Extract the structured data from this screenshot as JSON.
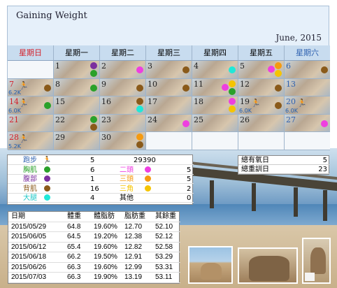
{
  "calendar": {
    "title": "Gaining Weight",
    "month_label": "June, 2015",
    "weekdays": [
      "星期日",
      "星期一",
      "星期二",
      "星期三",
      "星期四",
      "星期五",
      "星期六"
    ],
    "weekday_colors": [
      "#d4202a",
      "#000000",
      "#000000",
      "#000000",
      "#000000",
      "#000000",
      "#2f62b0"
    ],
    "weeks": [
      [
        {
          "day": "",
          "color": "",
          "runner": false,
          "dist": "",
          "dots": []
        },
        {
          "day": "1",
          "color": "normal",
          "runner": false,
          "dist": "",
          "dots": [
            "#7b2f9e",
            "#2aa12a"
          ]
        },
        {
          "day": "2",
          "color": "normal",
          "runner": false,
          "dist": "",
          "dots": [
            "#ee3fe0"
          ]
        },
        {
          "day": "3",
          "color": "normal",
          "runner": false,
          "dist": "",
          "dots": [
            "#8a5a1a"
          ]
        },
        {
          "day": "4",
          "color": "normal",
          "runner": false,
          "dist": "",
          "dots": [
            "#20e8d8"
          ]
        },
        {
          "day": "5",
          "color": "normal",
          "runner": false,
          "dist": "",
          "dots": [
            "#ee3fe0",
            "#f59a10",
            "#f5c400"
          ]
        },
        {
          "day": "6",
          "color": "blue",
          "runner": false,
          "dist": "",
          "dots": [
            "#8a5a1a"
          ]
        }
      ],
      [
        {
          "day": "7",
          "color": "red",
          "runner": true,
          "dist": "6.2K",
          "dots": [
            "#8a5a1a"
          ]
        },
        {
          "day": "8",
          "color": "normal",
          "runner": false,
          "dist": "",
          "dots": [
            "#2aa12a"
          ]
        },
        {
          "day": "9",
          "color": "normal",
          "runner": false,
          "dist": "",
          "dots": [
            "#8a5a1a"
          ]
        },
        {
          "day": "10",
          "color": "normal",
          "runner": false,
          "dist": "",
          "dots": [
            "#8a5a1a"
          ]
        },
        {
          "day": "11",
          "color": "normal",
          "runner": false,
          "dist": "",
          "dots": [
            "#ee3fe0",
            "#f5c400",
            "#2aa12a"
          ]
        },
        {
          "day": "12",
          "color": "normal",
          "runner": false,
          "dist": "",
          "dots": [
            "#8a5a1a"
          ]
        },
        {
          "day": "13",
          "color": "blue",
          "runner": false,
          "dist": "",
          "dots": []
        }
      ],
      [
        {
          "day": "14",
          "color": "red",
          "runner": true,
          "dist": "6.0K",
          "dots": [
            "#2aa12a"
          ]
        },
        {
          "day": "15",
          "color": "normal",
          "runner": false,
          "dist": "",
          "dots": []
        },
        {
          "day": "16",
          "color": "normal",
          "runner": false,
          "dist": "",
          "dots": [
            "#8a5a1a",
            "#20e8d8"
          ]
        },
        {
          "day": "17",
          "color": "normal",
          "runner": false,
          "dist": "",
          "dots": []
        },
        {
          "day": "18",
          "color": "normal",
          "runner": false,
          "dist": "",
          "dots": [
            "#ee3fe0",
            "#f5c400"
          ]
        },
        {
          "day": "19",
          "color": "normal",
          "runner": true,
          "dist": "6.0K",
          "dots": [
            "#8a5a1a"
          ]
        },
        {
          "day": "20",
          "color": "blue",
          "runner": true,
          "dist": "6.0K",
          "dots": []
        }
      ],
      [
        {
          "day": "21",
          "color": "red",
          "runner": false,
          "dist": "",
          "dots": []
        },
        {
          "day": "22",
          "color": "normal",
          "runner": false,
          "dist": "",
          "dots": [
            "#2aa12a",
            "#8a5a1a"
          ]
        },
        {
          "day": "23",
          "color": "normal",
          "runner": false,
          "dist": "",
          "dots": []
        },
        {
          "day": "24",
          "color": "normal",
          "runner": false,
          "dist": "",
          "dots": [
            "#ee3fe0"
          ]
        },
        {
          "day": "25",
          "color": "normal",
          "runner": false,
          "dist": "",
          "dots": []
        },
        {
          "day": "26",
          "color": "normal",
          "runner": false,
          "dist": "",
          "dots": []
        },
        {
          "day": "27",
          "color": "blue",
          "runner": false,
          "dist": "",
          "dots": [
            "#ee3fe0"
          ]
        }
      ],
      [
        {
          "day": "28",
          "color": "red",
          "runner": true,
          "dist": "5.2K",
          "dots": []
        },
        {
          "day": "29",
          "color": "normal",
          "runner": false,
          "dist": "",
          "dots": []
        },
        {
          "day": "30",
          "color": "normal",
          "runner": false,
          "dist": "",
          "dots": [
            "#f59a10",
            "#8a5a1a"
          ]
        },
        {
          "day": "",
          "color": "",
          "runner": false,
          "dist": "",
          "dots": []
        },
        {
          "day": "",
          "color": "",
          "runner": false,
          "dist": "",
          "dots": []
        },
        {
          "day": "",
          "color": "",
          "runner": false,
          "dist": "",
          "dots": []
        },
        {
          "day": "",
          "color": "",
          "runner": false,
          "dist": "",
          "dots": []
        }
      ]
    ]
  },
  "stats": {
    "rows": [
      {
        "label": "跑步",
        "label_color": "#2f62b0",
        "icon": "runner",
        "count": "5",
        "label2": "",
        "label2_color": "",
        "value2": "29390",
        "value2_color": "#000000",
        "dot": "",
        "dot2": ""
      },
      {
        "label": "胸肌",
        "label_color": "#2aa12a",
        "icon": "dot",
        "count": "6",
        "label2": "二頭",
        "label2_color": "#ee3fe0",
        "value2": "5",
        "value2_color": "#000000",
        "dot": "#2aa12a",
        "dot2": "#ee3fe0"
      },
      {
        "label": "腹部",
        "label_color": "#7b2f9e",
        "icon": "dot",
        "count": "1",
        "label2": "三頭",
        "label2_color": "#f59a10",
        "value2": "5",
        "value2_color": "#000000",
        "dot": "#7b2f9e",
        "dot2": "#f59a10"
      },
      {
        "label": "背肌",
        "label_color": "#8a5a1a",
        "icon": "dot",
        "count": "16",
        "label2": "三角",
        "label2_color": "#f5c400",
        "value2": "2",
        "value2_color": "#000000",
        "dot": "#8a5a1a",
        "dot2": "#f5c400"
      },
      {
        "label": "大腿",
        "label_color": "#20c8c8",
        "icon": "dot",
        "count": "4",
        "label2": "其他",
        "label2_color": "#000000",
        "value2": "0",
        "value2_color": "#000000",
        "dot": "#20e8d8",
        "dot2": "#ffffff"
      }
    ]
  },
  "summary": {
    "rows": [
      {
        "label": "總有氧日",
        "value": "5"
      },
      {
        "label": "總重訓日",
        "value": "23"
      }
    ]
  },
  "weight_table": {
    "headers": [
      "日期",
      "體重",
      "體脂肪",
      "脂肪重",
      "其餘重"
    ],
    "rows": [
      [
        "2015/05/29",
        "64.8",
        "19.60%",
        "12.70",
        "52.10"
      ],
      [
        "2015/06/05",
        "64.5",
        "19.20%",
        "12.38",
        "52.12"
      ],
      [
        "2015/06/12",
        "65.4",
        "19.60%",
        "12.82",
        "52.58"
      ],
      [
        "2015/06/18",
        "66.2",
        "19.50%",
        "12.91",
        "53.29"
      ],
      [
        "2015/06/26",
        "66.3",
        "19.60%",
        "12.99",
        "53.31"
      ],
      [
        "2015/07/03",
        "66.3",
        "19.90%",
        "13.19",
        "53.11"
      ]
    ]
  }
}
